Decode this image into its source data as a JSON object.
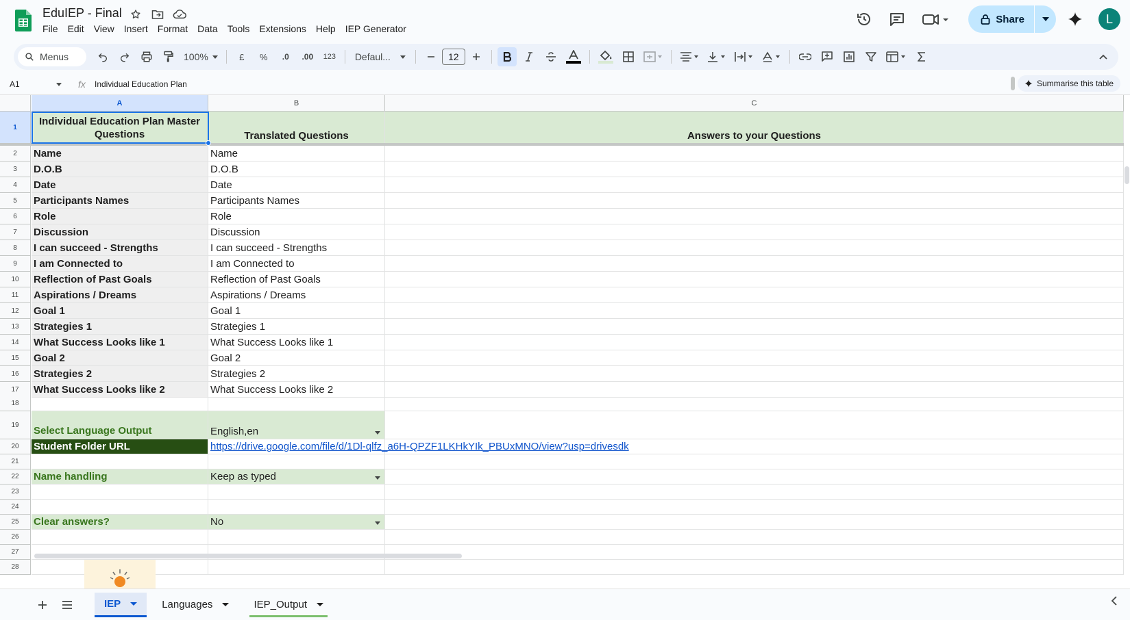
{
  "app": {
    "title": "EduIEP - Final",
    "menu": [
      "File",
      "Edit",
      "View",
      "Insert",
      "Format",
      "Data",
      "Tools",
      "Extensions",
      "Help",
      "IEP Generator"
    ],
    "share_label": "Share",
    "avatar_initial": "L"
  },
  "toolbar": {
    "search_label": "Menus",
    "zoom": "100%",
    "currency": "£",
    "percent": "%",
    "dec_decrease": ".0",
    "dec_increase": ".00",
    "number_format": "123",
    "font": "Defaul...",
    "font_size": "12"
  },
  "formula": {
    "cell_ref": "A1",
    "fx": "fx",
    "content": "Individual Education Plan",
    "summarise_label": "Summarise this table"
  },
  "columns": [
    "A",
    "B",
    "C"
  ],
  "header_row": {
    "a": "Individual Education Plan Master Questions",
    "b": "Translated Questions",
    "c": "Answers to your Questions"
  },
  "rows": [
    {
      "num": "2",
      "a": "Name",
      "b": "Name"
    },
    {
      "num": "3",
      "a": "D.O.B",
      "b": "D.O.B"
    },
    {
      "num": "4",
      "a": "Date",
      "b": "Date"
    },
    {
      "num": "5",
      "a": "Participants Names",
      "b": "Participants Names"
    },
    {
      "num": "6",
      "a": "Role",
      "b": "Role"
    },
    {
      "num": "7",
      "a": "Discussion",
      "b": "Discussion"
    },
    {
      "num": "8",
      "a": "I can succeed - Strengths",
      "b": "I can succeed - Strengths"
    },
    {
      "num": "9",
      "a": "I am Connected to",
      "b": "I am Connected to"
    },
    {
      "num": "10",
      "a": "Reflection of Past Goals",
      "b": "Reflection of Past Goals"
    },
    {
      "num": "11",
      "a": "Aspirations / Dreams",
      "b": "Aspirations / Dreams"
    },
    {
      "num": "12",
      "a": "Goal 1",
      "b": "Goal 1"
    },
    {
      "num": "13",
      "a": "Strategies 1",
      "b": "Strategies 1"
    },
    {
      "num": "14",
      "a": "What Success Looks like 1",
      "b": "What Success Looks like 1"
    },
    {
      "num": "15",
      "a": "Goal 2",
      "b": "Goal 2"
    },
    {
      "num": "16",
      "a": "Strategies 2",
      "b": "Strategies 2"
    },
    {
      "num": "17",
      "a": "What Success Looks like 2",
      "b": "What Success Looks like 2"
    }
  ],
  "row_numbers": {
    "r1": "1",
    "r18": "18",
    "r19": "19",
    "r20": "20",
    "r21": "21",
    "r22": "22",
    "r23": "23",
    "r24": "24",
    "r25": "25",
    "r26": "26",
    "r27": "27",
    "r28": "28"
  },
  "settings": {
    "language_label": "Select Language Output",
    "language_value": "English,en",
    "folder_label": "Student Folder URL",
    "folder_url": "https://drive.google.com/file/d/1Dl-qlfz_a6H-QPZF1LKHkYIk_PBUxMNO/view?usp=drivesdk",
    "name_label": "Name handling",
    "name_value": "Keep as typed",
    "clear_label": "Clear answers?",
    "clear_value": "No"
  },
  "sheets": [
    "IEP",
    "Languages",
    "IEP_Output"
  ],
  "colors": {
    "accent": "#0b57d0",
    "header_green": "#d9ead3",
    "dark_green": "#274e13",
    "green_text": "#38761d",
    "link": "#1155cc"
  }
}
